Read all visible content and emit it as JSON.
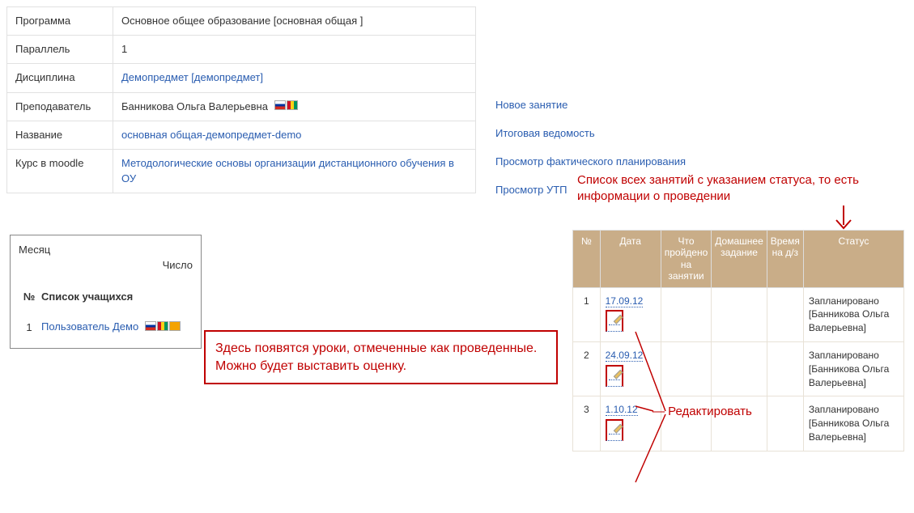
{
  "info": {
    "program_label": "Программа",
    "program_value": "Основное общее образование [основная общая ]",
    "parallel_label": "Параллель",
    "parallel_value": "1",
    "discipline_label": "Дисциплина",
    "discipline_link": "Демопредмет [демопредмет]",
    "teacher_label": "Преподаватель",
    "teacher_value": "Банникова Ольга Валерьевна",
    "name_label": "Название",
    "name_link": "основная общая-демопредмет-demo",
    "moodle_label": "Курс в moodle",
    "moodle_link": "Методологические основы организации дистанционного обучения в ОУ"
  },
  "right_links": {
    "new_lesson": "Новое занятие",
    "final_sheet": "Итоговая ведомость",
    "view_actual": "Просмотр фактического планирования",
    "view_utp": "Просмотр УТП"
  },
  "annotations": {
    "top_right": "Список всех занятий с указанием статуса, то есть информации о проведении",
    "callout": "Здесь появятся уроки, отмеченные как проведенные. Можно будет выставить оценку.",
    "edit_label": "Редактировать"
  },
  "schedule": {
    "headers": {
      "num": "№",
      "date": "Дата",
      "done": "Что пройдено на занятии",
      "hw": "Домашнее задание",
      "hw_time": "Время на д/з",
      "status": "Статус"
    },
    "rows": [
      {
        "n": "1",
        "date": "17.09.12",
        "status": "Запланировано [Банникова Ольга Валерьевна]"
      },
      {
        "n": "2",
        "date": "24.09.12",
        "status": "Запланировано [Банникова Ольга Валерьевна]"
      },
      {
        "n": "3",
        "date": "1.10.12",
        "status": "Запланировано [Банникова Ольга Валерьевна]"
      }
    ]
  },
  "monthbox": {
    "month": "Месяц",
    "number": "Число",
    "col_num": "№",
    "col_list": "Список учащихся",
    "row1_n": "1",
    "row1_user": "Пользователь Демо"
  }
}
